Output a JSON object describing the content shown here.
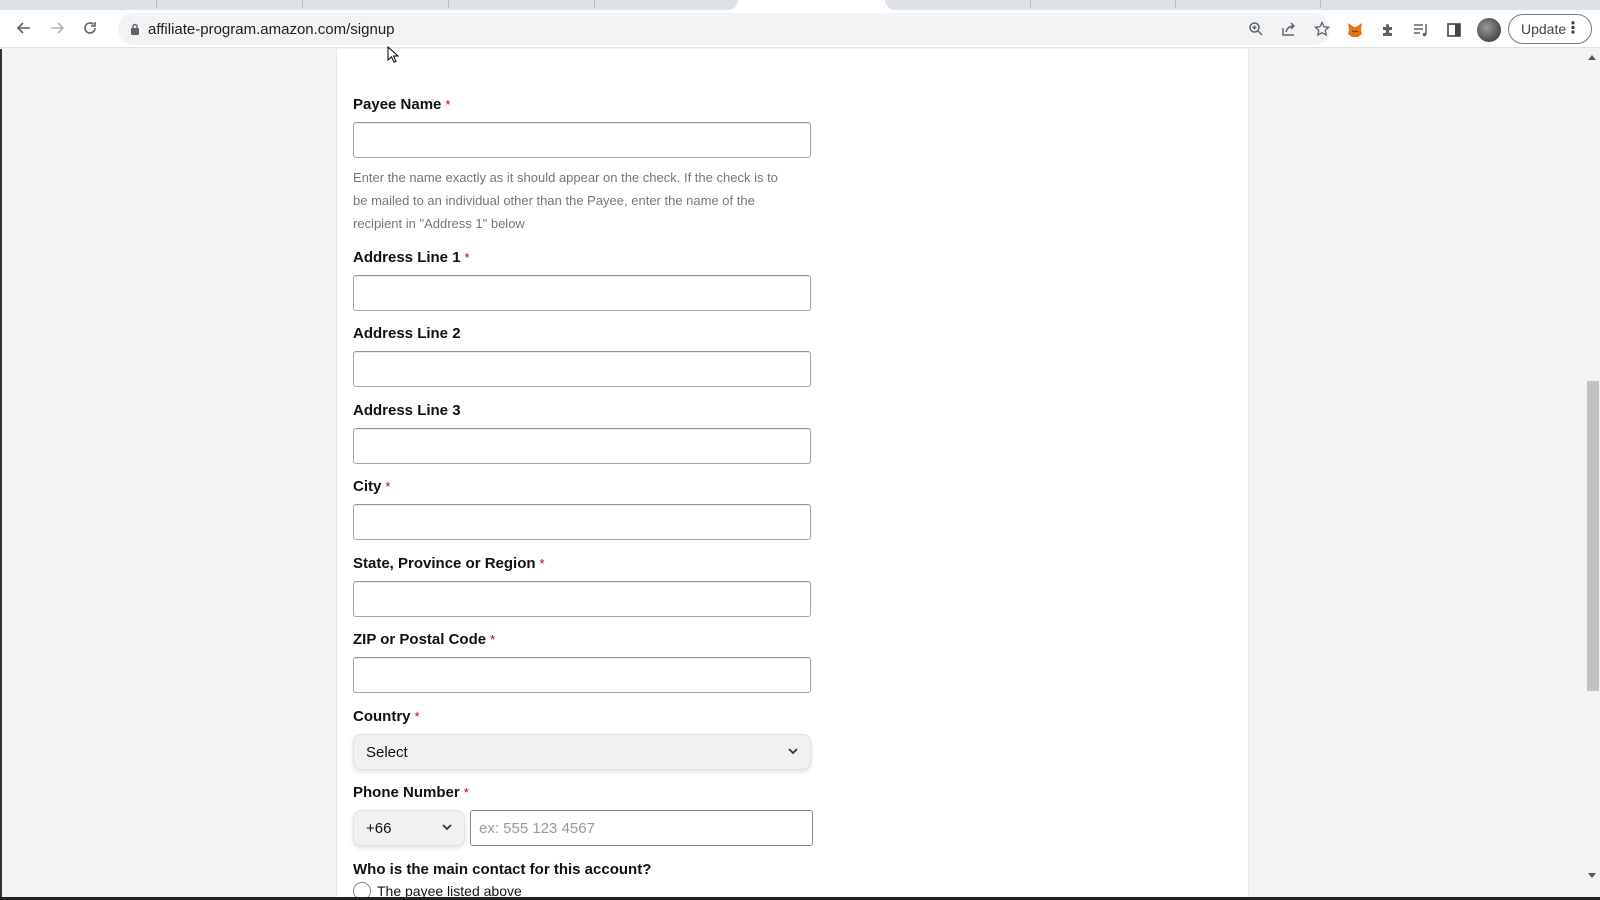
{
  "browser": {
    "url": "affiliate-program.amazon.com/signup",
    "update_label": "Update",
    "icons": {
      "back": "arrow-left",
      "forward": "arrow-right",
      "reload": "reload",
      "lock": "lock",
      "zoom": "zoom-in",
      "share": "share",
      "bookmark": "star",
      "metamask": "fox",
      "extensions": "puzzle",
      "media": "music-queue",
      "sidepanel": "side-panel",
      "menu": "kebab"
    }
  },
  "form": {
    "payee_name": {
      "label": "Payee Name",
      "required": "*",
      "value": "",
      "hint": "Enter the name exactly as it should appear on the check. If the check is to be mailed to an individual other than the Payee, enter the name of the recipient in \"Address 1\" below"
    },
    "address1": {
      "label": "Address Line 1",
      "required": "*",
      "value": ""
    },
    "address2": {
      "label": "Address Line 2",
      "value": ""
    },
    "address3": {
      "label": "Address Line 3",
      "value": ""
    },
    "city": {
      "label": "City",
      "required": "*",
      "value": ""
    },
    "state": {
      "label": "State, Province or Region",
      "required": "*",
      "value": ""
    },
    "zip": {
      "label": "ZIP or Postal Code",
      "required": "*",
      "value": ""
    },
    "country": {
      "label": "Country",
      "required": "*",
      "selected": "Select"
    },
    "phone": {
      "label": "Phone Number",
      "required": "*",
      "country_code": "+66",
      "placeholder": "ex: 555 123 4567",
      "value": ""
    },
    "main_contact": {
      "question": "Who is the main contact for this account?",
      "options": [
        "The payee listed above"
      ]
    }
  }
}
